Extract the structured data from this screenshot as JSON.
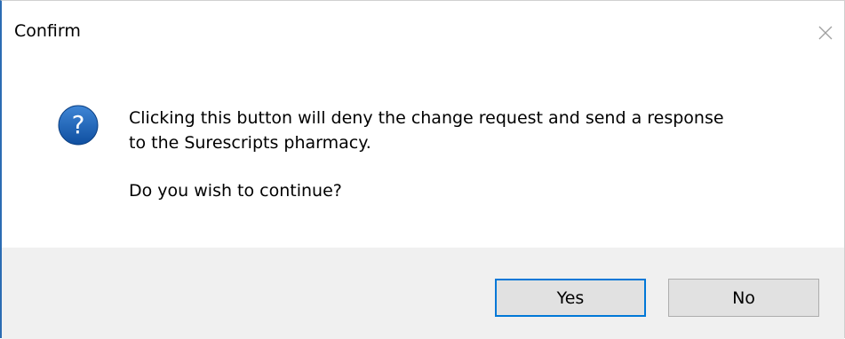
{
  "dialog": {
    "title": "Confirm",
    "icon": "question-icon",
    "message_line_1": "Clicking this button will deny the change request and send a response",
    "message_line_2": "to the Surescripts pharmacy.",
    "prompt": "Do you wish to continue?",
    "yes_label": "Yes",
    "no_label": "No",
    "close_icon": "close-icon"
  },
  "colors": {
    "accent": "#2b6cb3",
    "icon_blue": "#1a5fb4",
    "footer_bg": "#f0f0f0",
    "button_bg": "#e1e1e1",
    "default_button_border": "#0078d7"
  }
}
